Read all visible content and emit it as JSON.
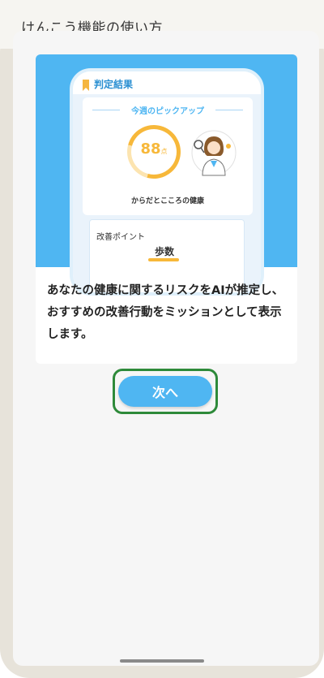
{
  "header": {
    "title": "けんこう機能の使い方"
  },
  "tutorial": {
    "illustration": {
      "result_title": "判定結果",
      "pick_title": "今週のピックアップ",
      "score": "88",
      "score_unit": "点",
      "caption": "からだとこころの健康",
      "sub_label": "改善ポイント",
      "sub_value": "歩数"
    },
    "description": "あなたの健康に関するリスクをAIが推定し、おすすめの改善行動をミッションとして表示します。"
  },
  "next_button": {
    "label": "次へ"
  },
  "colors": {
    "accent": "#4fb6f2",
    "highlight": "#f7b83a",
    "focus_outline": "#2e8a3a"
  }
}
